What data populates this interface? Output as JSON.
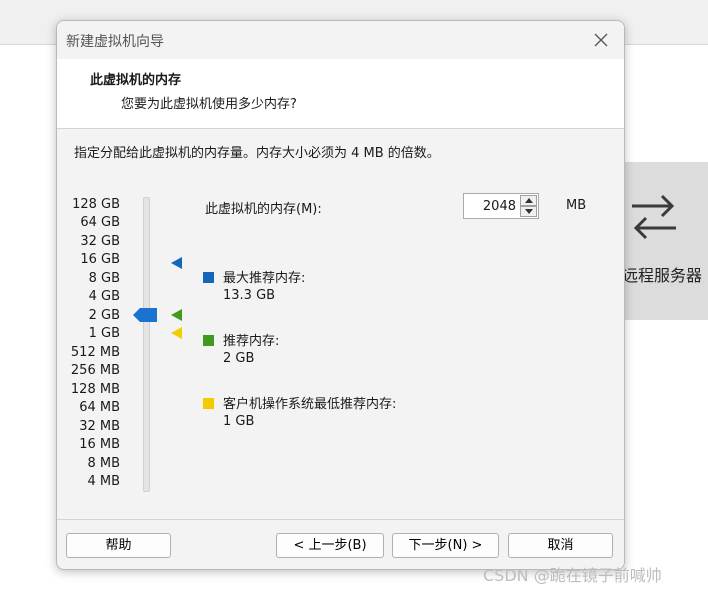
{
  "background": {
    "trademark": "™",
    "remote_label": "远程服务器"
  },
  "dialog": {
    "title": "新建虚拟机向导",
    "header_title": "此虚拟机的内存",
    "header_subtitle": "您要为此虚拟机使用多少内存?",
    "instruction": "指定分配给此虚拟机的内存量。内存大小必须为 4 MB 的倍数。"
  },
  "memory_scale": [
    "128 GB",
    "64 GB",
    "32 GB",
    "16 GB",
    "8 GB",
    "4 GB",
    "2 GB",
    "1 GB",
    "512 MB",
    "256 MB",
    "128 MB",
    "64 MB",
    "32 MB",
    "16 MB",
    "8 MB",
    "4 MB"
  ],
  "slider": {
    "selected": "2 GB"
  },
  "memory_input": {
    "label": "此虚拟机的内存(M):",
    "value": "2048",
    "unit": "MB"
  },
  "legend": {
    "max": {
      "title": "最大推荐内存:",
      "value": "13.3 GB",
      "color": "#1565b8"
    },
    "recommended": {
      "title": "推荐内存:",
      "value": "2 GB",
      "color": "#3f9a1e"
    },
    "minimum": {
      "title": "客户机操作系统最低推荐内存:",
      "value": "1 GB",
      "color": "#f2cc00"
    }
  },
  "buttons": {
    "help": "帮助",
    "back": "< 上一步(B)",
    "next": "下一步(N) >",
    "cancel": "取消"
  },
  "watermark": "CSDN @跪在镜子前喊帅",
  "colors": {
    "thumb": "#1a73d0",
    "max_marker": "#1565b8",
    "rec_marker": "#3f9a1e",
    "min_marker": "#f2cc00"
  }
}
